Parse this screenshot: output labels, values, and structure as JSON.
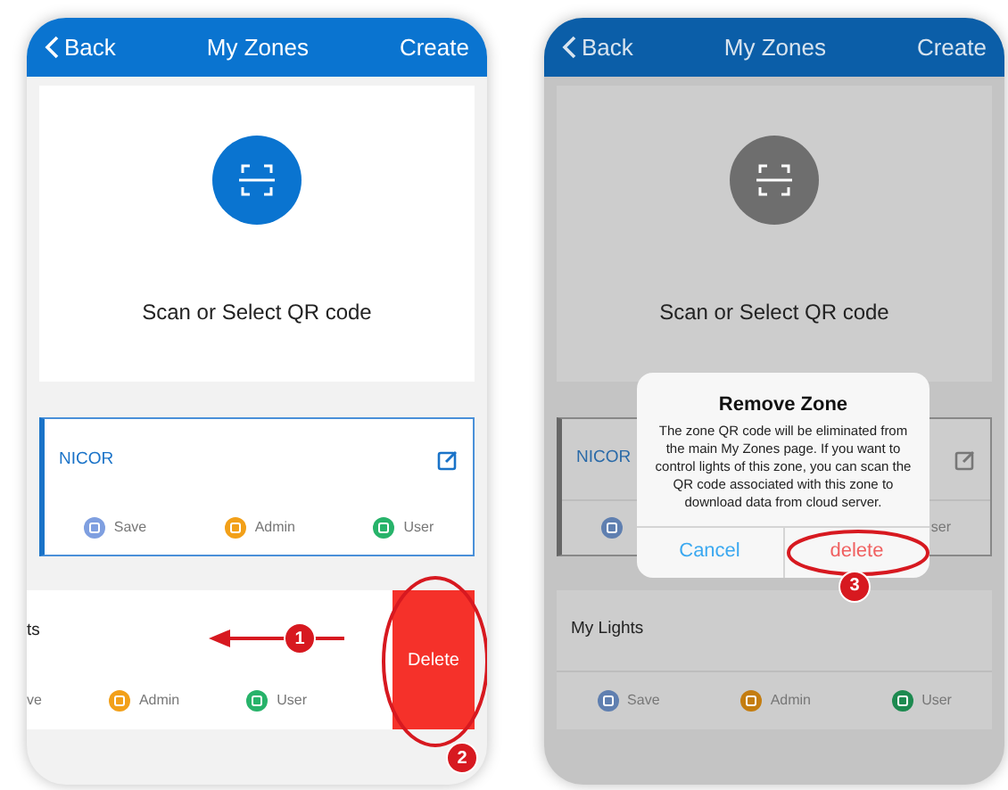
{
  "screens": [
    {
      "dimmed": false,
      "header": {
        "back": "Back",
        "title": "My Zones",
        "action": "Create"
      },
      "scan": {
        "label": "Scan or Select QR code"
      },
      "zones": [
        {
          "name": "NICOR",
          "selected": true,
          "swiped": false,
          "roles": [
            {
              "kind": "save",
              "label": "Save"
            },
            {
              "kind": "admin",
              "label": "Admin"
            },
            {
              "kind": "user",
              "label": "User"
            }
          ]
        },
        {
          "name": "ts",
          "selected": false,
          "swiped": true,
          "swipe_step": "1",
          "delete": {
            "label": "Delete",
            "step": "2"
          },
          "roles": [
            {
              "kind": "text",
              "label": "ve"
            },
            {
              "kind": "admin",
              "label": "Admin"
            },
            {
              "kind": "user",
              "label": "User"
            }
          ]
        }
      ]
    },
    {
      "dimmed": true,
      "header": {
        "back": "Back",
        "title": "My Zones",
        "action": "Create"
      },
      "scan": {
        "label": "Scan or Select QR code"
      },
      "zones": [
        {
          "name": "NICOR",
          "selected": true,
          "swiped": false,
          "roles": [
            {
              "kind": "save"
            },
            {
              "kind": "text",
              "label": "ser"
            }
          ]
        },
        {
          "name": "My Lights",
          "selected": false,
          "swiped": false,
          "roles": [
            {
              "kind": "save",
              "label": "Save"
            },
            {
              "kind": "admin",
              "label": "Admin"
            },
            {
              "kind": "user",
              "label": "User"
            }
          ]
        }
      ],
      "dialog": {
        "title": "Remove Zone",
        "message": "The zone QR code will be eliminated from the main My Zones page. If you want to control lights of this zone, you can scan the QR code associated with this zone to download data from cloud server.",
        "buttons": [
          {
            "kind": "cancel",
            "label": "Cancel"
          },
          {
            "kind": "delete",
            "label": "delete",
            "step": "3"
          }
        ]
      }
    }
  ]
}
